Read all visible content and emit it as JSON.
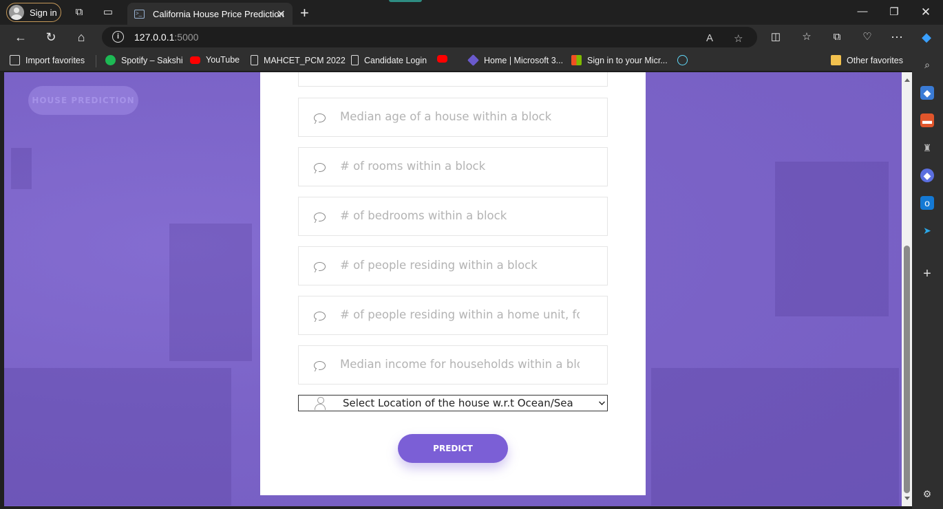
{
  "browser": {
    "signin_label": "Sign in",
    "tab_title": "California House Price Prediction",
    "url_host": "127.0.0.1",
    "url_port": ":5000"
  },
  "bookmarks": [
    {
      "label": "Import favorites"
    },
    {
      "label": "Spotify – Sakshi"
    },
    {
      "label": "YouTube"
    },
    {
      "label": "MAHCET_PCM 2022"
    },
    {
      "label": "Candidate Login"
    },
    {
      "label": "Home | Microsoft 3..."
    },
    {
      "label": "Sign in to your Micr..."
    },
    {
      "label": "Other favorites"
    }
  ],
  "page": {
    "badge": "HOUSE PREDICTION",
    "fields": [
      {
        "placeholder": "Median age of a house within a block"
      },
      {
        "placeholder": "# of rooms within a block"
      },
      {
        "placeholder": "# of bedrooms within a block"
      },
      {
        "placeholder": "# of people residing within a block"
      },
      {
        "placeholder": "# of people residing within a home unit, for"
      },
      {
        "placeholder": "Median income for households within a blo"
      }
    ],
    "select_value": "Select Location of the house w.r.t Ocean/Sea",
    "predict_label": "PREDICT"
  },
  "colors": {
    "accent": "#7b5fd6",
    "overlay": "#7d62d4"
  }
}
